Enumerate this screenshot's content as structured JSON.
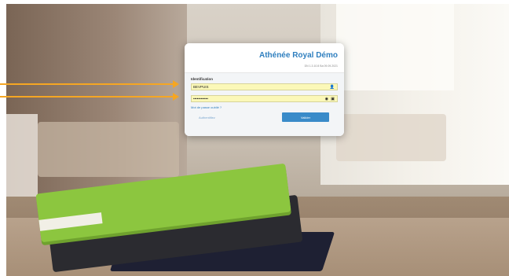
{
  "login": {
    "brand": "Athénée Royal Démo",
    "version": "DN 1.3.10.8 Ba 09.09.2021",
    "section_title": "Identification",
    "username_value": "BEVPUIS",
    "password_value": "••••••••••••",
    "forgot_link": "Mot de passe oublié ?",
    "auth_link": "Authentifiez",
    "submit_label": "Valider"
  },
  "icons": {
    "user": "user-icon",
    "eye": "eye-icon",
    "lock": "lock-icon",
    "arrow": "arrow-right-icon"
  },
  "colors": {
    "accent": "#2f7fbf",
    "button": "#3a8bc9",
    "field_fill": "#fbf8b8",
    "arrow": "#f5a623"
  }
}
